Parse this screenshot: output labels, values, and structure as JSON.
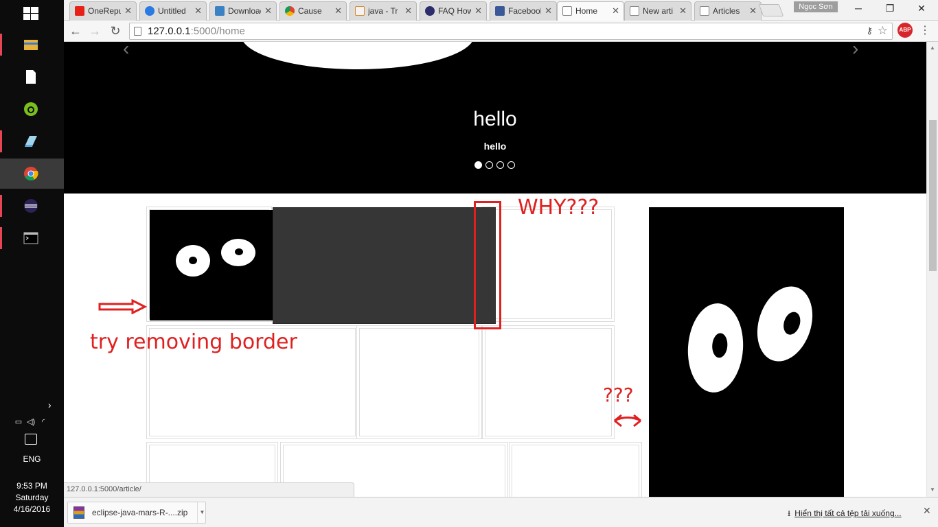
{
  "taskbar": {
    "apps": [
      "file-explorer",
      "notepad",
      "utorrent",
      "glass-app",
      "chrome",
      "eclipse",
      "command-prompt"
    ],
    "tray": {
      "language": "ENG",
      "time": "9:53 PM",
      "day": "Saturday",
      "date": "4/16/2016"
    }
  },
  "browser": {
    "profile_name": "Ngọc Sơn",
    "tabs": [
      {
        "title": "OneRepublic",
        "favicon": "youtube-icon"
      },
      {
        "title": "Untitled",
        "favicon": "google-docs-icon"
      },
      {
        "title": "Downloads",
        "favicon": "download-icon"
      },
      {
        "title": "Cause",
        "favicon": "chrome-icon"
      },
      {
        "title": "java - Tr",
        "favicon": "stackoverflow-icon"
      },
      {
        "title": "FAQ How",
        "favicon": "globe-icon"
      },
      {
        "title": "Facebook",
        "favicon": "facebook-icon"
      },
      {
        "title": "Home",
        "favicon": "page-icon",
        "active": true
      },
      {
        "title": "New arti",
        "favicon": "page-icon"
      },
      {
        "title": "Articles",
        "favicon": "page-icon"
      }
    ],
    "url": {
      "host": "127.0.0.1",
      "path": ":5000/home"
    },
    "abp_label": "ABP"
  },
  "page": {
    "carousel": {
      "title": "hello",
      "subtitle": "hello",
      "slide_count": 4,
      "active_slide": 0
    },
    "annotations": {
      "why": "WHY???",
      "try_removing_border": "try removing border",
      "question": "???"
    }
  },
  "status_url": "127.0.0.1:5000/article/",
  "downloads": {
    "item_name": "eclipse-java-mars-R-....zip",
    "show_all_label": "Hiển thị tất cả tệp tải xuống..."
  },
  "colors": {
    "annotation": "#e02020",
    "active_taskbar": "#3a3a3a"
  }
}
